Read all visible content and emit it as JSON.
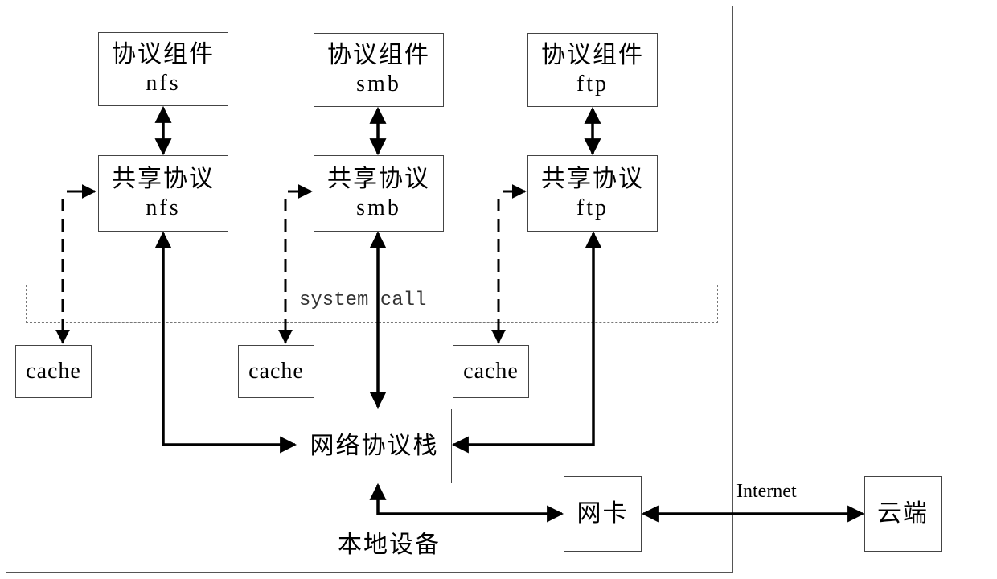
{
  "outer_container": {
    "label": "本地设备"
  },
  "columns": [
    {
      "component": {
        "title": "协议组件",
        "name": "nfs"
      },
      "shared": {
        "title": "共享协议",
        "name": "nfs"
      },
      "cache": "cache"
    },
    {
      "component": {
        "title": "协议组件",
        "name": "smb"
      },
      "shared": {
        "title": "共享协议",
        "name": "smb"
      },
      "cache": "cache"
    },
    {
      "component": {
        "title": "协议组件",
        "name": "ftp"
      },
      "shared": {
        "title": "共享协议",
        "name": "ftp"
      },
      "cache": "cache"
    }
  ],
  "system_call": {
    "label": "system call"
  },
  "network_stack": {
    "label": "网络协议栈"
  },
  "nic": {
    "label": "网卡"
  },
  "cloud": {
    "label": "云端"
  },
  "internet": {
    "label": "Internet"
  }
}
